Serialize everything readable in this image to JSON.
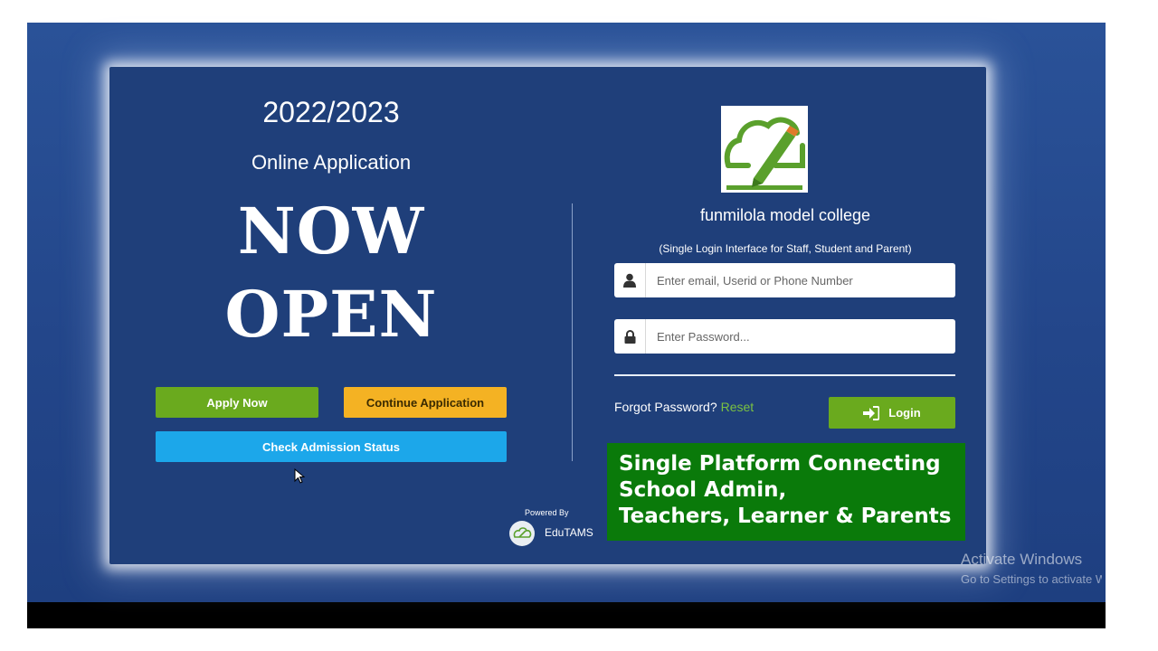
{
  "left": {
    "year": "2022/2023",
    "online_application": "Online Application",
    "headline_line1": "NOW",
    "headline_line2": "OPEN",
    "apply_now": "Apply Now",
    "continue_application": "Continue Application",
    "check_status": "Check Admission Status"
  },
  "right": {
    "college_name": "funmilola model college",
    "subtitle": "(Single Login Interface for Staff, Student and Parent)",
    "email_placeholder": "Enter email, Userid or Phone Number",
    "password_placeholder": "Enter Password...",
    "forgot_text": "Forgot Password?",
    "reset_link": "Reset",
    "login_label": "Login"
  },
  "banner": {
    "line1": "Single Platform Connecting",
    "line2": "School Admin,",
    "line3": "Teachers, Learner & Parents"
  },
  "footer": {
    "powered_by": "Powered By",
    "brand": "EduTAMS"
  },
  "overlay": {
    "activate_title": "Activate Windows",
    "activate_sub": "Go to Settings to activate Windows."
  },
  "colors": {
    "green": "#6aaa1e",
    "orange": "#f4b223",
    "blue": "#1ca7ea",
    "banner_green": "#0a7a0a"
  }
}
